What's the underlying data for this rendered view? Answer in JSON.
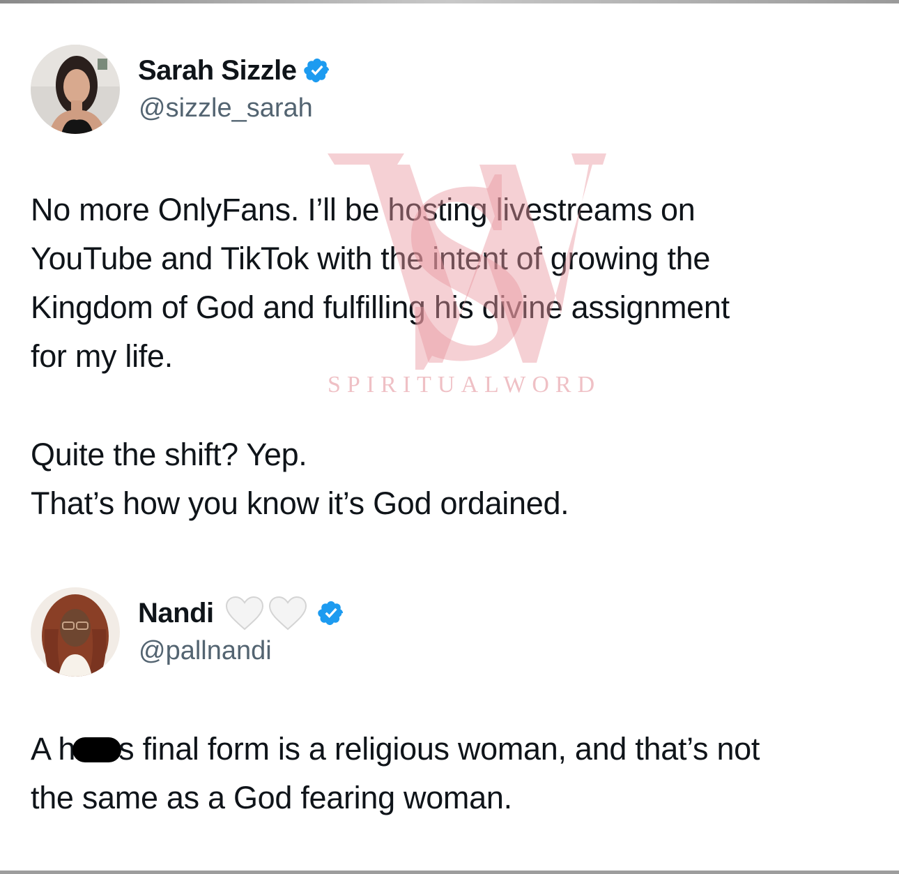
{
  "tweets": [
    {
      "display_name": "Sarah Sizzle",
      "handle": "@sizzle_sarah",
      "verified": true,
      "paragraphs": [
        "No more OnlyFans. I’ll be hosting livestreams on\nYouTube and TikTok with the intent of growing the\nKingdom of God and fulfilling his divine assignment\nfor my life.",
        "Quite the shift? Yep.\nThat’s how you know it’s God ordained."
      ]
    },
    {
      "display_name": "Nandi",
      "handle": "@pallnandi",
      "verified": true,
      "name_emojis": [
        "white-heart-icon",
        "white-heart-icon"
      ],
      "text_before_redaction": "A h",
      "text_after_redaction": "s final form is a religious woman, and that’s not\nthe same as a God fearing woman."
    }
  ],
  "watermark": {
    "monogram": "SW",
    "text": "SPIRITUALWORD",
    "color": "#e8a0a8"
  },
  "colors": {
    "verified_badge": "#1d9bf0",
    "text": "#0f1419",
    "handle": "#536471"
  }
}
